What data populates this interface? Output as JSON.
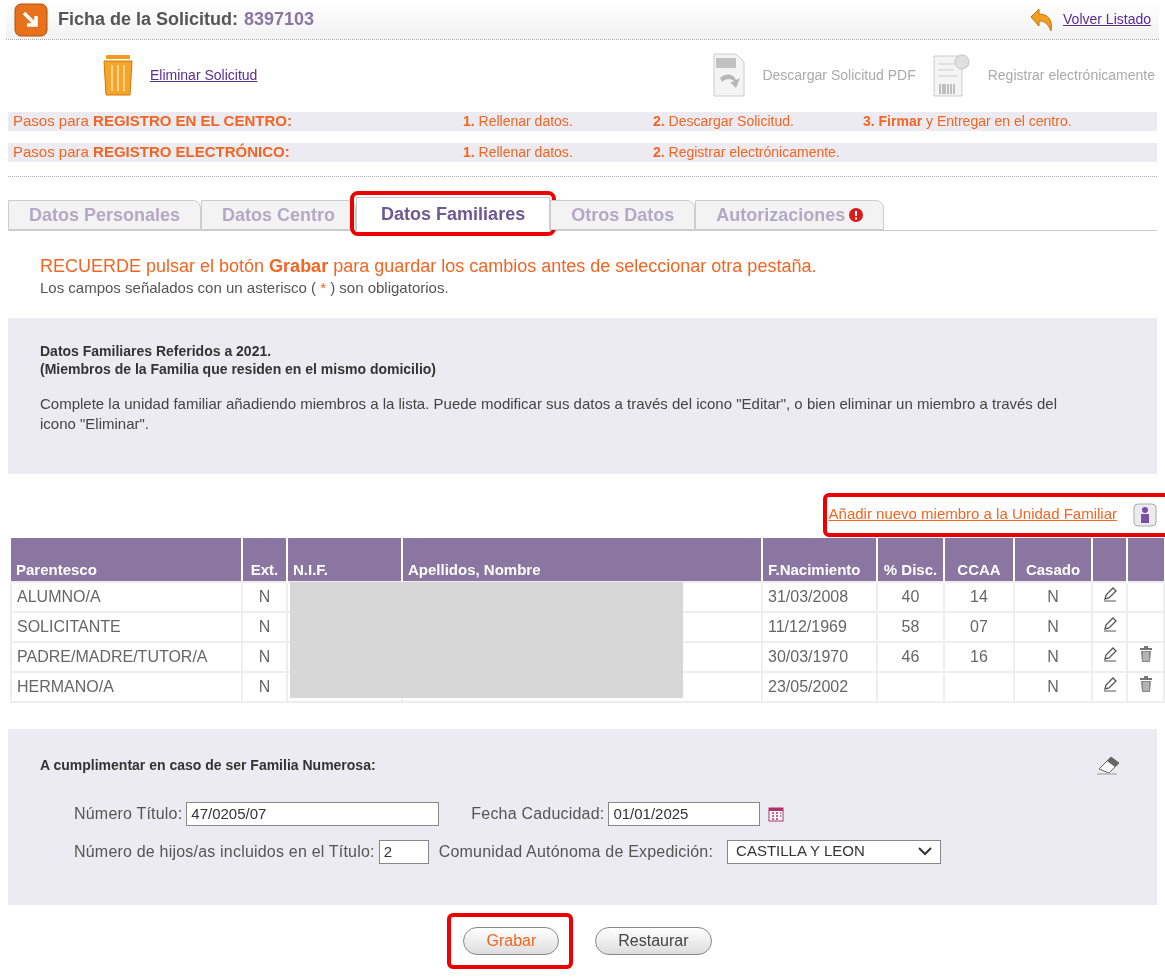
{
  "header": {
    "title": "Ficha de la Solicitud:",
    "number": "8397103",
    "back_link": "Volver Listado"
  },
  "actions": [
    {
      "kind": "trash",
      "label": "Eliminar Solicitud",
      "disabled": false
    },
    {
      "kind": "pdf",
      "label": "Descargar Solicitud PDF",
      "disabled": true
    },
    {
      "kind": "register",
      "label": "Registrar electrónicamente",
      "disabled": true
    }
  ],
  "steps": [
    {
      "label": "Pasos para **REGISTRO EN EL CENTRO:**",
      "items": [
        "**1.** Rellenar datos.",
        "**2.** Descargar Solicitud.",
        "**3. Firmar** y Entregar en el centro."
      ]
    },
    {
      "label": "Pasos para **REGISTRO ELECTRÓNICO:**",
      "items": [
        "**1.** Rellenar datos.",
        "**2.** Registrar electrónicamente."
      ]
    }
  ],
  "tabs": [
    {
      "label": "Datos Personales",
      "selected": false,
      "alert": false,
      "highlighted": false
    },
    {
      "label": "Datos Centro",
      "selected": false,
      "alert": false,
      "highlighted": false
    },
    {
      "label": "Datos Familiares",
      "selected": true,
      "alert": false,
      "highlighted": true
    },
    {
      "label": "Otros Datos",
      "selected": false,
      "alert": false,
      "highlighted": false
    },
    {
      "label": "Autorizaciones",
      "selected": false,
      "alert": true,
      "highlighted": false
    }
  ],
  "notice": {
    "reminder": "RECUERDE pulsar el botón **Grabar** para guardar los cambios antes de seleccionar otra pestaña.",
    "required_before": "Los campos señalados con un asterisco (",
    "required_mark": "*",
    "required_after": ") son obligatorios."
  },
  "info": {
    "title_lines": [
      "Datos Familiares Referidos a 2021.",
      "(Miembros de la Familia que residen en el mismo domicilio)"
    ],
    "text": "Complete la unidad familiar añadiendo miembros a la lista. Puede modificar sus datos a través del icono \"Editar\", o bien eliminar un miembro a través del icono \"Eliminar\"."
  },
  "add_member": {
    "label": "Añadir nuevo miembro a la Unidad Familiar",
    "highlighted": true
  },
  "table": {
    "columns": [
      "Parentesco",
      "Ext.",
      "N.I.F.",
      "Apellidos, Nombre",
      "F.Nacimiento",
      "% Disc.",
      "CCAA",
      "Casado"
    ],
    "rows": [
      {
        "parentesco": "ALUMNO/A",
        "ext": "N",
        "fecha": "31/03/2008",
        "disc": "40",
        "ccaa": "14",
        "casado": "N",
        "deletable": false
      },
      {
        "parentesco": "SOLICITANTE",
        "ext": "N",
        "fecha": "11/12/1969",
        "disc": "58",
        "ccaa": "07",
        "casado": "N",
        "deletable": false
      },
      {
        "parentesco": "PADRE/MADRE/TUTOR/A",
        "ext": "N",
        "fecha": "30/03/1970",
        "disc": "46",
        "ccaa": "16",
        "casado": "N",
        "deletable": true
      },
      {
        "parentesco": "HERMANO/A",
        "ext": "N",
        "fecha": "23/05/2002",
        "disc": "",
        "ccaa": "",
        "casado": "N",
        "deletable": true
      }
    ]
  },
  "familia": {
    "title": "A cumplimentar en caso de ser Familia Numerosa:",
    "numero_titulo": {
      "label": "Número Título:",
      "value": "47/0205/07"
    },
    "fecha_caducidad": {
      "label": "Fecha Caducidad:",
      "value": "01/01/2025"
    },
    "hijos": {
      "label": "Número de hijos/as incluidos en el Título:",
      "value": "2"
    },
    "comunidad": {
      "label": "Comunidad Autónoma de Expedición:",
      "value": "CASTILLA Y LEON"
    }
  },
  "buttons": [
    {
      "label": "Grabar",
      "kind": "primary",
      "highlighted": true
    },
    {
      "label": "Restaurar",
      "kind": "secondary",
      "highlighted": false
    }
  ]
}
